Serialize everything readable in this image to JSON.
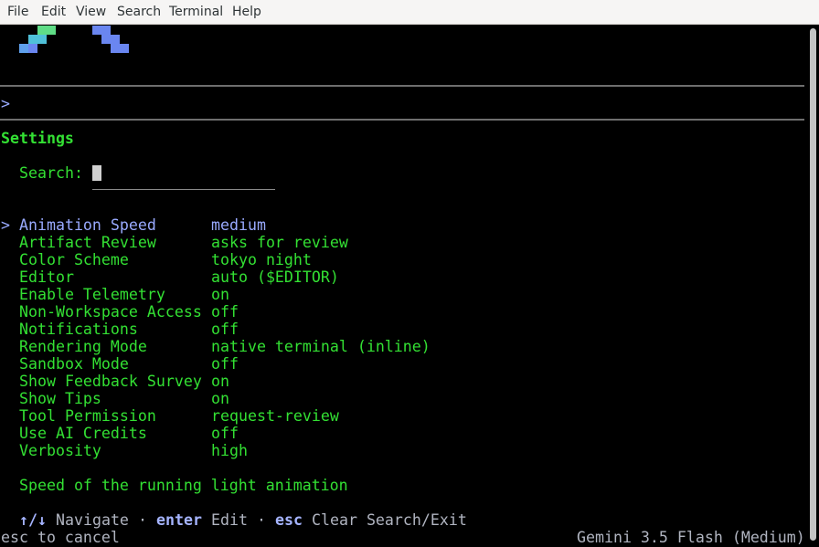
{
  "menubar": {
    "items": [
      "File",
      "Edit",
      "View",
      "Search",
      "Terminal",
      "Help"
    ]
  },
  "colors": {
    "text_green": "#33e033",
    "selected_blue": "#99aaff",
    "logo_blue": "#6a86f0",
    "logo_green": "#5fdc86",
    "hint_grey": "#b0b4c0"
  },
  "prompt": {
    "symbol": ">"
  },
  "settings": {
    "title": "Settings",
    "search_label": "Search:",
    "search_value": "",
    "selection_marker": ">",
    "selected_index": 0,
    "items": [
      {
        "label": "Animation Speed",
        "value": "medium"
      },
      {
        "label": "Artifact Review",
        "value": "asks for review"
      },
      {
        "label": "Color Scheme",
        "value": "tokyo night"
      },
      {
        "label": "Editor",
        "value": "auto ($EDITOR)"
      },
      {
        "label": "Enable Telemetry",
        "value": "on"
      },
      {
        "label": "Non-Workspace Access",
        "value": "off"
      },
      {
        "label": "Notifications",
        "value": "off"
      },
      {
        "label": "Rendering Mode",
        "value": "native terminal (inline)"
      },
      {
        "label": "Sandbox Mode",
        "value": "off"
      },
      {
        "label": "Show Feedback Survey",
        "value": "on"
      },
      {
        "label": "Show Tips",
        "value": "on"
      },
      {
        "label": "Tool Permission",
        "value": "request-review"
      },
      {
        "label": "Use AI Credits",
        "value": "off"
      },
      {
        "label": "Verbosity",
        "value": "high"
      }
    ],
    "description": "Speed of the running light animation"
  },
  "hints": {
    "nav_keys": "↑/↓",
    "nav_label": "Navigate",
    "sep": "·",
    "enter_key": "enter",
    "enter_label": "Edit",
    "esc_key": "esc",
    "esc_label": "Clear Search/Exit"
  },
  "footer": {
    "left": "esc to cancel",
    "right": "Gemini 3.5 Flash (Medium)"
  }
}
